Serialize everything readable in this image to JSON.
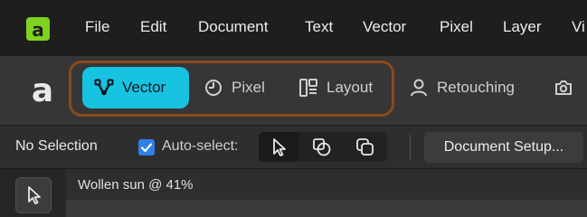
{
  "menu": {
    "items": [
      "File",
      "Edit",
      "Document",
      "Text",
      "Vector",
      "Pixel",
      "Layer",
      "Vi"
    ]
  },
  "personas": {
    "items": [
      {
        "label": "Vector",
        "icon": "pen-node-icon",
        "active": true
      },
      {
        "label": "Pixel",
        "icon": "pixel-circle-icon",
        "active": false
      },
      {
        "label": "Layout",
        "icon": "layout-icon",
        "active": false
      },
      {
        "label": "Retouching",
        "icon": "person-icon",
        "active": false
      }
    ],
    "overflow_icon": "camera-icon"
  },
  "context": {
    "selection": "No Selection",
    "auto_select_label": "Auto-select:",
    "auto_select_checked": true,
    "document_setup": "Document Setup..."
  },
  "document": {
    "title": "Wollen sun @ 41%"
  },
  "colors": {
    "accent": "#17c3e0",
    "highlight_outline": "#8a4a1c",
    "app_icon": "#7ed321",
    "checkbox": "#2f7fe6"
  }
}
